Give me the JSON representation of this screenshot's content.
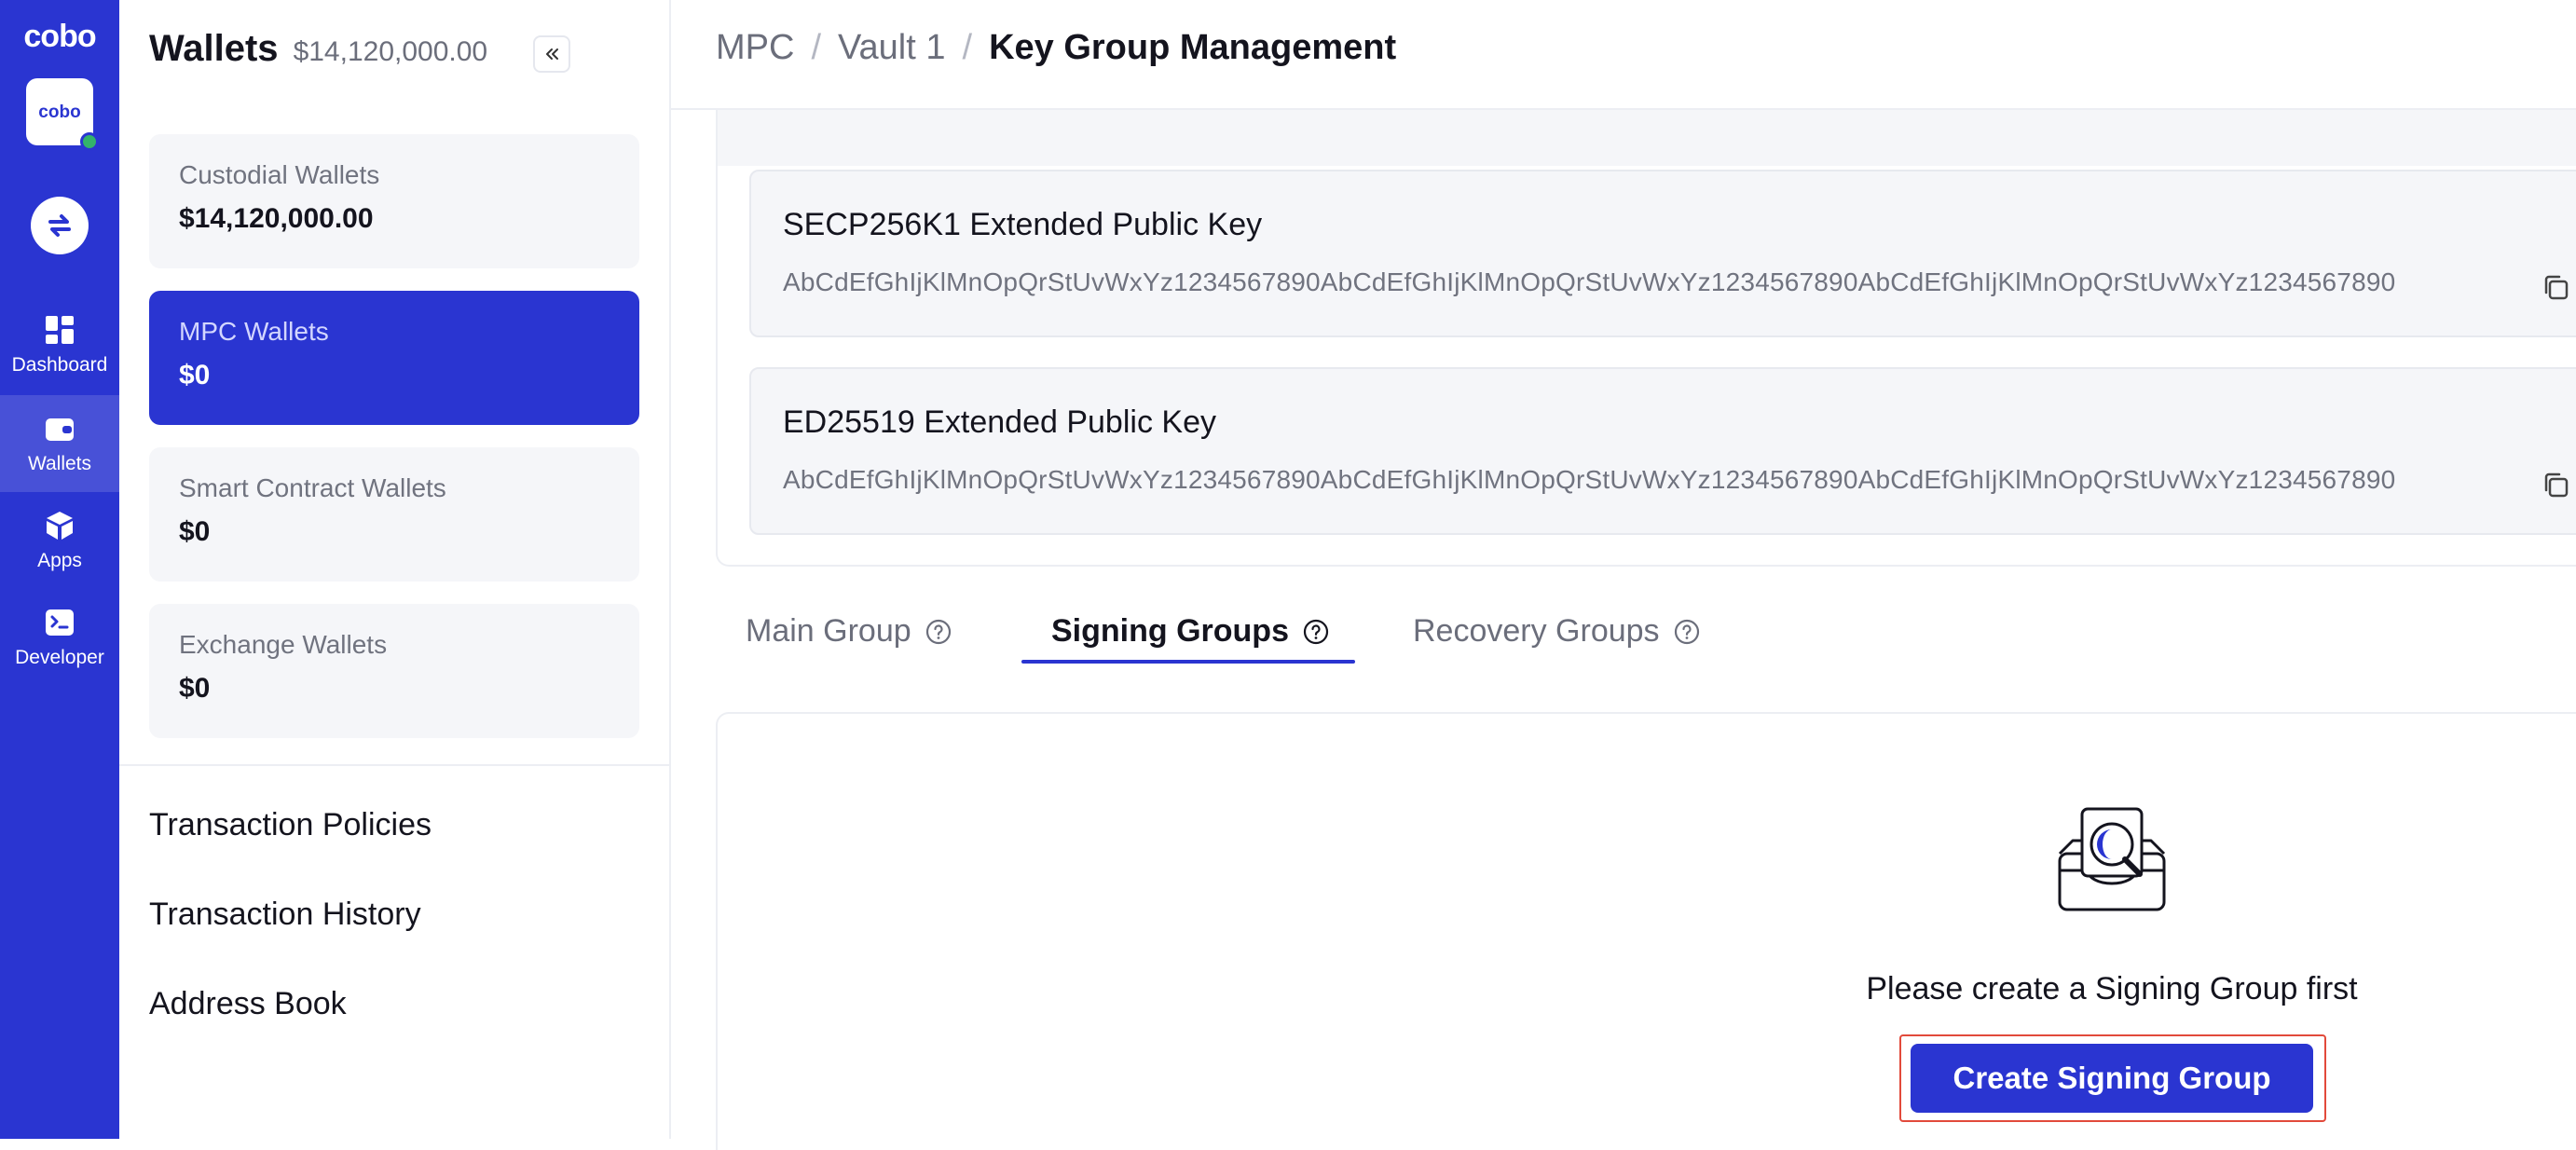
{
  "rail": {
    "brand": "cobo",
    "org_avatar_text": "cobo",
    "items": [
      {
        "label": "Dashboard",
        "icon": "grid-icon"
      },
      {
        "label": "Wallets",
        "icon": "wallet-icon"
      },
      {
        "label": "Apps",
        "icon": "cube-icon"
      },
      {
        "label": "Developer",
        "icon": "terminal-icon"
      }
    ]
  },
  "sidebar": {
    "title": "Wallets",
    "total": "$14,120,000.00",
    "wallets": [
      {
        "name": "Custodial Wallets",
        "value": "$14,120,000.00"
      },
      {
        "name": "MPC Wallets",
        "value": "$0"
      },
      {
        "name": "Smart Contract Wallets",
        "value": "$0"
      },
      {
        "name": "Exchange Wallets",
        "value": "$0"
      }
    ],
    "links": [
      "Transaction Policies",
      "Transaction History",
      "Address Book"
    ]
  },
  "breadcrumb": [
    "MPC",
    "Vault 1",
    "Key Group Management"
  ],
  "keys": [
    {
      "title": "SECP256K1 Extended Public Key",
      "value": "AbCdEfGhIjKlMnOpQrStUvWxYz1234567890AbCdEfGhIjKlMnOpQrStUvWxYz1234567890AbCdEfGhIjKlMnOpQrStUvWxYz1234567890"
    },
    {
      "title": "ED25519 Extended Public Key",
      "value": "AbCdEfGhIjKlMnOpQrStUvWxYz1234567890AbCdEfGhIjKlMnOpQrStUvWxYz1234567890AbCdEfGhIjKlMnOpQrStUvWxYz1234567890"
    }
  ],
  "tabs": [
    "Main Group",
    "Signing Groups",
    "Recovery Groups"
  ],
  "active_tab": "Signing Groups",
  "empty_state": {
    "message": "Please create a Signing Group first",
    "button": "Create Signing Group"
  },
  "colors": {
    "brand": "#2a35d1",
    "online": "#33b36b",
    "highlight": "#e24a3b"
  }
}
